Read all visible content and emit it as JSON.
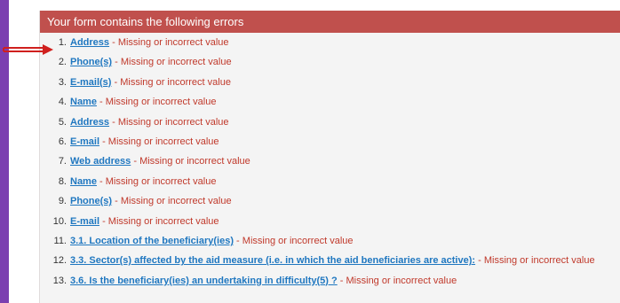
{
  "header": {
    "title": "Your form contains the following errors"
  },
  "errors": [
    {
      "num": "1.",
      "field": "Address",
      "message": "Missing or incorrect value"
    },
    {
      "num": "2.",
      "field": "Phone(s)",
      "message": "Missing or incorrect value"
    },
    {
      "num": "3.",
      "field": "E-mail(s)",
      "message": "Missing or incorrect value"
    },
    {
      "num": "4.",
      "field": "Name",
      "message": "Missing or incorrect value"
    },
    {
      "num": "5.",
      "field": "Address",
      "message": "Missing or incorrect value"
    },
    {
      "num": "6.",
      "field": "E-mail",
      "message": "Missing or incorrect value"
    },
    {
      "num": "7.",
      "field": "Web address",
      "message": "Missing or incorrect value"
    },
    {
      "num": "8.",
      "field": "Name",
      "message": "Missing or incorrect value"
    },
    {
      "num": "9.",
      "field": "Phone(s)",
      "message": "Missing or incorrect value"
    },
    {
      "num": "10.",
      "field": "E-mail",
      "message": "Missing or incorrect value"
    },
    {
      "num": "11.",
      "field": "3.1. Location of the beneficiary(ies)",
      "message": "Missing or incorrect value"
    },
    {
      "num": "12.",
      "field": "3.3. Sector(s) affected by the aid measure (i.e. in which the aid beneficiaries are active):",
      "message": "Missing or incorrect value"
    },
    {
      "num": "13.",
      "field": "3.6. Is the beneficiary(ies) an undertaking in difficulty(5) ?",
      "message": "Missing or incorrect value"
    }
  ],
  "separator": " - ",
  "colors": {
    "header_bg": "#c0504d",
    "link": "#1f77c0",
    "error_text": "#c0392b",
    "arrow": "#d0201e",
    "background": "#6a2fa0"
  },
  "annotation": {
    "icon": "red-arrow-icon"
  }
}
